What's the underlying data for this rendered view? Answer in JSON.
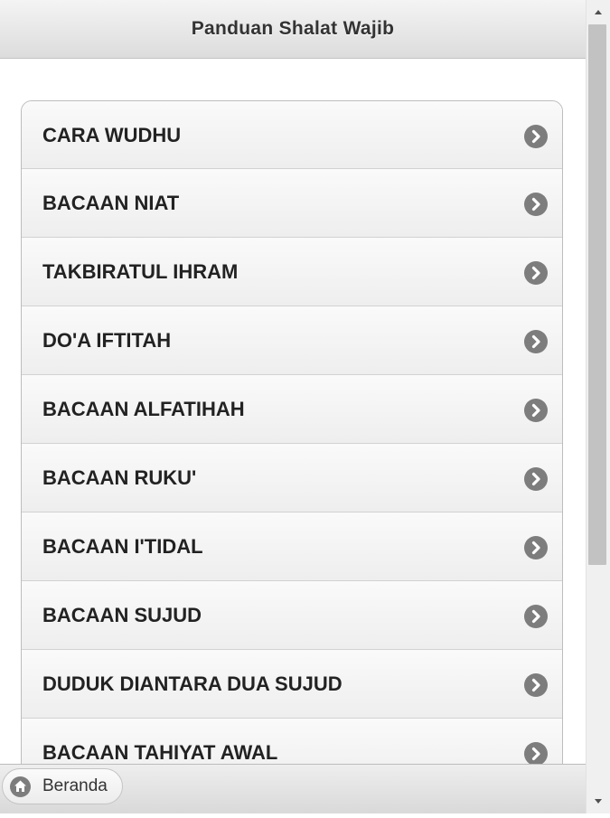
{
  "header": {
    "title": "Panduan Shalat Wajib"
  },
  "menu": {
    "items": [
      {
        "label": "CARA WUDHU"
      },
      {
        "label": "BACAAN NIAT"
      },
      {
        "label": "TAKBIRATUL IHRAM"
      },
      {
        "label": "DO'A IFTITAH"
      },
      {
        "label": "BACAAN ALFATIHAH"
      },
      {
        "label": "BACAAN RUKU'"
      },
      {
        "label": "BACAAN I'TIDAL"
      },
      {
        "label": "BACAAN SUJUD"
      },
      {
        "label": "DUDUK DIANTARA DUA SUJUD"
      },
      {
        "label": "BACAAN TAHIYAT AWAL"
      }
    ],
    "item_icon": "chevron-right-icon"
  },
  "footer": {
    "home_label": "Beranda",
    "home_icon": "home-icon"
  },
  "colors": {
    "icon_gray": "#7d7d7d",
    "header_text": "#333333",
    "item_text": "#222222"
  }
}
